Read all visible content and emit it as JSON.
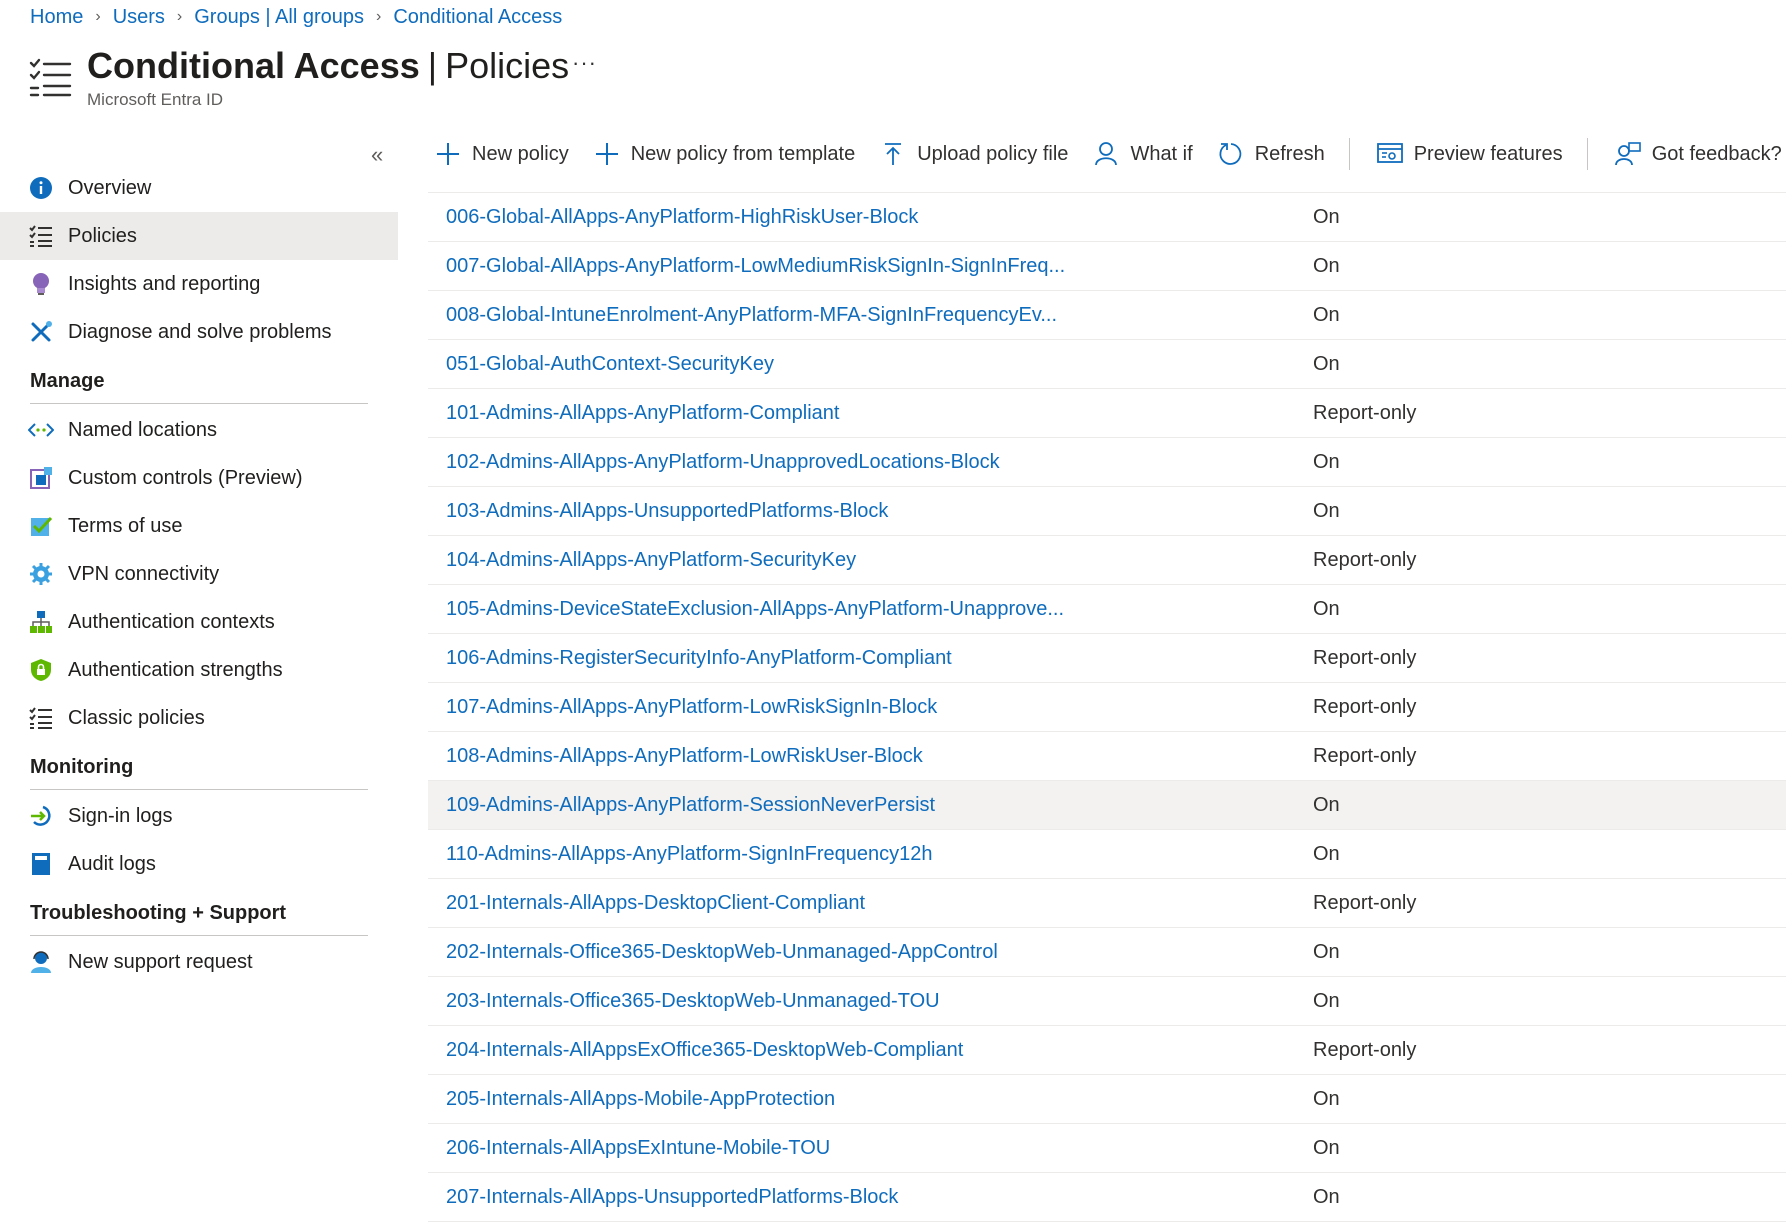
{
  "breadcrumb": [
    "Home",
    "Users",
    "Groups | All groups",
    "Conditional Access"
  ],
  "header": {
    "title_main": "Conditional Access",
    "title_sep": "|",
    "title_sub": "Policies",
    "more": "···",
    "subtitle": "Microsoft Entra ID"
  },
  "sidebar": {
    "collapse": "«",
    "top_items": [
      {
        "label": "Overview",
        "icon": "info-icon"
      },
      {
        "label": "Policies",
        "icon": "list-icon",
        "active": true
      },
      {
        "label": "Insights and reporting",
        "icon": "lightbulb-icon"
      },
      {
        "label": "Diagnose and solve problems",
        "icon": "wrench-icon"
      }
    ],
    "manage_title": "Manage",
    "manage_items": [
      {
        "label": "Named locations",
        "icon": "named-locations-icon"
      },
      {
        "label": "Custom controls (Preview)",
        "icon": "custom-controls-icon"
      },
      {
        "label": "Terms of use",
        "icon": "terms-icon"
      },
      {
        "label": "VPN connectivity",
        "icon": "gear-icon"
      },
      {
        "label": "Authentication contexts",
        "icon": "hierarchy-icon"
      },
      {
        "label": "Authentication strengths",
        "icon": "shield-icon"
      },
      {
        "label": "Classic policies",
        "icon": "list-icon"
      }
    ],
    "monitoring_title": "Monitoring",
    "monitoring_items": [
      {
        "label": "Sign-in logs",
        "icon": "sign-in-icon"
      },
      {
        "label": "Audit logs",
        "icon": "book-icon"
      }
    ],
    "support_title": "Troubleshooting + Support",
    "support_items": [
      {
        "label": "New support request",
        "icon": "support-person-icon"
      }
    ]
  },
  "toolbar": {
    "new_policy": "New policy",
    "new_from_template": "New policy from template",
    "upload": "Upload policy file",
    "what_if": "What if",
    "refresh": "Refresh",
    "preview": "Preview features",
    "feedback": "Got feedback?"
  },
  "policies": [
    {
      "name": "006-Global-AllApps-AnyPlatform-HighRiskUser-Block",
      "state": "On"
    },
    {
      "name": "007-Global-AllApps-AnyPlatform-LowMediumRiskSignIn-SignInFreq...",
      "state": "On"
    },
    {
      "name": "008-Global-IntuneEnrolment-AnyPlatform-MFA-SignInFrequencyEv...",
      "state": "On"
    },
    {
      "name": "051-Global-AuthContext-SecurityKey",
      "state": "On"
    },
    {
      "name": "101-Admins-AllApps-AnyPlatform-Compliant",
      "state": "Report-only"
    },
    {
      "name": "102-Admins-AllApps-AnyPlatform-UnapprovedLocations-Block",
      "state": "On"
    },
    {
      "name": "103-Admins-AllApps-UnsupportedPlatforms-Block",
      "state": "On"
    },
    {
      "name": "104-Admins-AllApps-AnyPlatform-SecurityKey",
      "state": "Report-only"
    },
    {
      "name": "105-Admins-DeviceStateExclusion-AllApps-AnyPlatform-Unapprove...",
      "state": "On"
    },
    {
      "name": "106-Admins-RegisterSecurityInfo-AnyPlatform-Compliant",
      "state": "Report-only"
    },
    {
      "name": "107-Admins-AllApps-AnyPlatform-LowRiskSignIn-Block",
      "state": "Report-only"
    },
    {
      "name": "108-Admins-AllApps-AnyPlatform-LowRiskUser-Block",
      "state": "Report-only"
    },
    {
      "name": "109-Admins-AllApps-AnyPlatform-SessionNeverPersist",
      "state": "On"
    },
    {
      "name": "110-Admins-AllApps-AnyPlatform-SignInFrequency12h",
      "state": "On"
    },
    {
      "name": "201-Internals-AllApps-DesktopClient-Compliant",
      "state": "Report-only"
    },
    {
      "name": "202-Internals-Office365-DesktopWeb-Unmanaged-AppControl",
      "state": "On"
    },
    {
      "name": "203-Internals-Office365-DesktopWeb-Unmanaged-TOU",
      "state": "On"
    },
    {
      "name": "204-Internals-AllAppsExOffice365-DesktopWeb-Compliant",
      "state": "Report-only"
    },
    {
      "name": "205-Internals-AllApps-Mobile-AppProtection",
      "state": "On"
    },
    {
      "name": "206-Internals-AllAppsExIntune-Mobile-TOU",
      "state": "On"
    },
    {
      "name": "207-Internals-AllApps-UnsupportedPlatforms-Block",
      "state": "On"
    }
  ],
  "colors": {
    "link": "#0f6cbd",
    "active_bg": "#edebe9",
    "hover_row": "#f3f2f1"
  }
}
